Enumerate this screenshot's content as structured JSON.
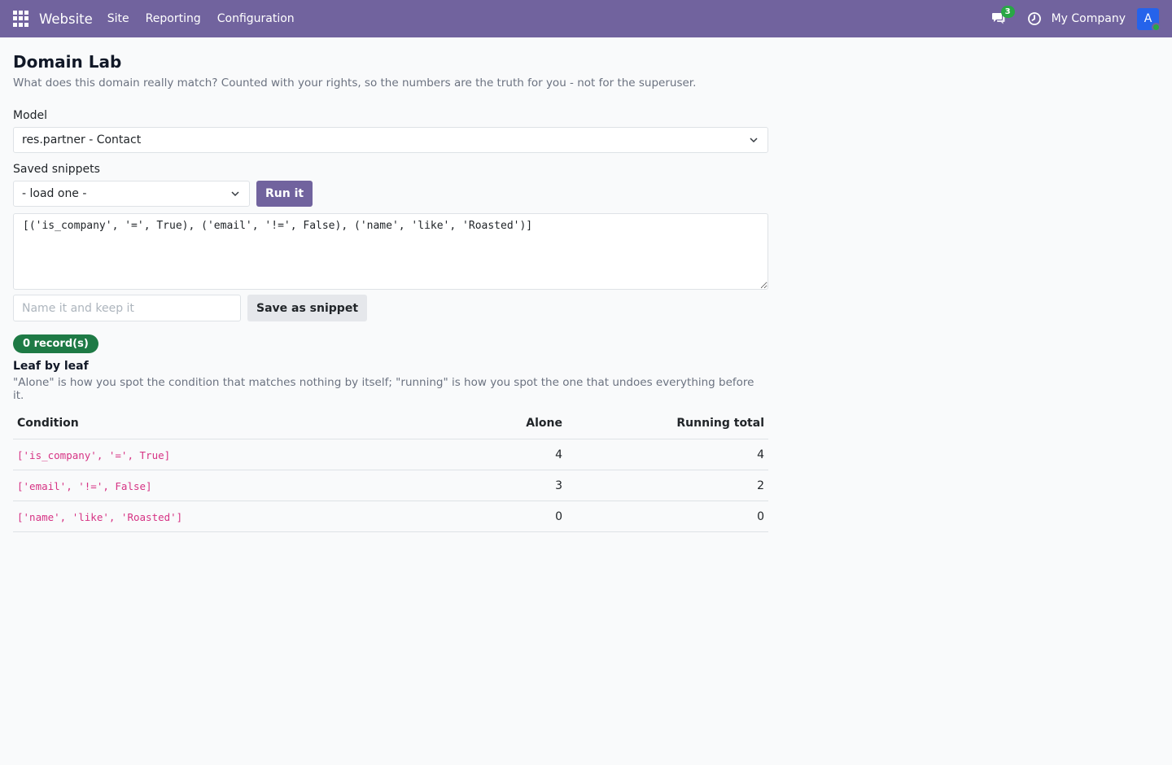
{
  "navbar": {
    "brand": "Website",
    "menu": [
      "Site",
      "Reporting",
      "Configuration"
    ],
    "chat_count": "3",
    "company": "My Company",
    "avatar_letter": "A",
    "icons": [
      "apps-grid-icon",
      "chat-icon",
      "clock-icon"
    ],
    "bg_color": "#71639e"
  },
  "page": {
    "title": "Domain Lab",
    "subtitle": "What does this domain really match? Counted with your rights, so the numbers are the truth for you - not for the superuser."
  },
  "form": {
    "model_label": "Model",
    "model_value": "res.partner - Contact",
    "snippets_label": "Saved snippets",
    "snippets_value": "- load one -",
    "run_label": "Run it",
    "domain_value": "[('is_company', '=', True), ('email', '!=', False), ('name', 'like', 'Roasted')]",
    "name_placeholder": "Name it and keep it",
    "save_label": "Save as snippet"
  },
  "result": {
    "count_label": "0 record(s)",
    "leaf_title": "Leaf by leaf",
    "leaf_desc": "\"Alone\" is how you spot the condition that matches nothing by itself; \"running\" is how you spot the one that undoes everything before it."
  },
  "table": {
    "headers": [
      "Condition",
      "Alone",
      "Running total"
    ],
    "rows": [
      {
        "condition": "['is_company', '=', True]",
        "alone": "4",
        "running": "4"
      },
      {
        "condition": "['email', '!=', False]",
        "alone": "3",
        "running": "2"
      },
      {
        "condition": "['name', 'like', 'Roasted']",
        "alone": "0",
        "running": "0"
      }
    ]
  }
}
